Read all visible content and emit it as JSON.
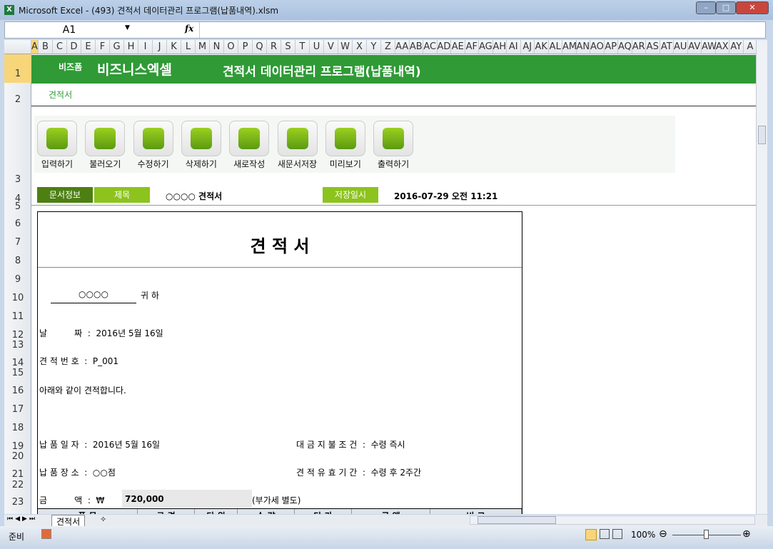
{
  "window": {
    "title": "Microsoft Excel - (493) 견적서 데이터관리 프로그램(납품내역).xlsm",
    "app_icon": "X"
  },
  "formula_bar": {
    "name_box": "A1",
    "fx": "fx",
    "value": ""
  },
  "columns": [
    "A",
    "B",
    "C",
    "D",
    "E",
    "F",
    "G",
    "H",
    "I",
    "J",
    "K",
    "L",
    "M",
    "N",
    "O",
    "P",
    "Q",
    "R",
    "S",
    "T",
    "U",
    "V",
    "W",
    "X",
    "Y",
    "Z",
    "AA",
    "AB",
    "AC",
    "AD",
    "AE",
    "AF",
    "AG",
    "AH",
    "AI",
    "AJ",
    "AK",
    "AL",
    "AM",
    "AN",
    "AO",
    "AP",
    "AQ",
    "AR",
    "AS",
    "AT",
    "AU",
    "AV",
    "AW",
    "AX",
    "AY",
    "A"
  ],
  "rows": [
    "1",
    "2",
    "3",
    "4",
    "5",
    "6",
    "7",
    "8",
    "9",
    "10",
    "11",
    "12",
    "13",
    "14",
    "15",
    "16",
    "17",
    "18",
    "19",
    "20",
    "21",
    "22",
    "23"
  ],
  "banner": {
    "brand_small": "비즈폼",
    "brand": "비즈니스엑셀",
    "title": "견적서 데이터관리 프로그램(납품내역)",
    "subtitle": "견적서"
  },
  "toolbar": [
    {
      "label": "입력하기",
      "icon": "pencil-icon"
    },
    {
      "label": "불러오기",
      "icon": "load-icon"
    },
    {
      "label": "수정하기",
      "icon": "refresh-icon"
    },
    {
      "label": "삭제하기",
      "icon": "trash-icon"
    },
    {
      "label": "새로작성",
      "icon": "new-icon"
    },
    {
      "label": "새문서저장",
      "icon": "save-icon"
    },
    {
      "label": "미리보기",
      "icon": "monitor-icon"
    },
    {
      "label": "출력하기",
      "icon": "print-icon"
    }
  ],
  "info": {
    "doc_info": "문서정보",
    "title_label": "제목",
    "title_value": "○○○○ 견적서",
    "saved_label": "저장일시",
    "saved_value": "2016-07-29  오전 11:21"
  },
  "document": {
    "heading": "견          적          서",
    "recipient": "○○○○",
    "honorific": "귀 하",
    "date_label": "날          짜  :  2016년 5월 16일",
    "number_label": "견 적 번 호  :  P_001",
    "intro": "아래와 같이 견적합니다.",
    "delivery_date": "납 품 일 자  :  2016년 5월 16일",
    "payment": "대 금 지 불 조 건  :  수령 즉시",
    "delivery_place": "납 품 장 소  :  ○○점",
    "validity": "견 적 유 효 기 간  :  수령 후 2주간",
    "amount_label": "금          액  :  ₩",
    "amount": "720,000",
    "vat": "(부가세 별도)",
    "table_headers": [
      "품     목",
      "규 격",
      "단 위",
      "수 량",
      "단 가",
      "금     액",
      "비     고"
    ]
  },
  "sheet_tabs": [
    "견적서"
  ],
  "status": {
    "ready": "준비",
    "zoom": "100%"
  }
}
